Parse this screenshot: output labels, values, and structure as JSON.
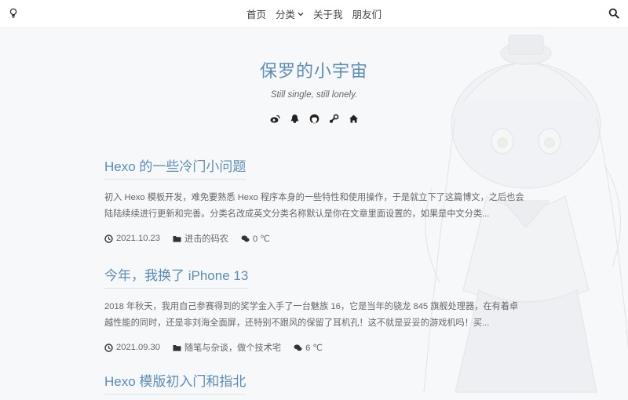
{
  "nav": {
    "items": [
      {
        "label": "首页"
      },
      {
        "label": "分类"
      },
      {
        "label": "关于我"
      },
      {
        "label": "朋友们"
      }
    ]
  },
  "header": {
    "title": "保罗的小宇宙",
    "subtitle": "Still single, still lonely.",
    "social_icons": [
      "weibo-icon",
      "qq-icon",
      "github-icon",
      "steam-icon",
      "home-icon"
    ]
  },
  "posts": [
    {
      "title": "Hexo 的一些冷门小问题",
      "excerpt": "初入 Hexo 模板开发，难免要熟悉 Hexo 程序本身的一些特性和使用操作，于是就立下了这篇博文，之后也会陆陆续续进行更新和完善。分类名改成英文分类名称默认是你在文章里面设置的，如果是中文分类...",
      "date": "2021.10.23",
      "category": "进击的码农",
      "comments": "0 ℃"
    },
    {
      "title": "今年，我换了 iPhone 13",
      "excerpt": "2018 年秋天，我用自己参赛得到的奖学金入手了一台魅族 16，它是当年的骁龙 845 旗舰处理器，在有着卓越性能的同时，还是非刘海全面屏，还特别不跟风的保留了耳机孔！这不就是妥妥的游戏机吗！买...",
      "date": "2021.09.30",
      "category": "随笔与杂谈，做个技术宅",
      "comments": "6 ℃"
    },
    {
      "title": "Hexo 模版初入门和指北"
    }
  ],
  "colors": {
    "accent": "#5b8dbb",
    "text": "#555555",
    "background": "#f7f8fa"
  }
}
